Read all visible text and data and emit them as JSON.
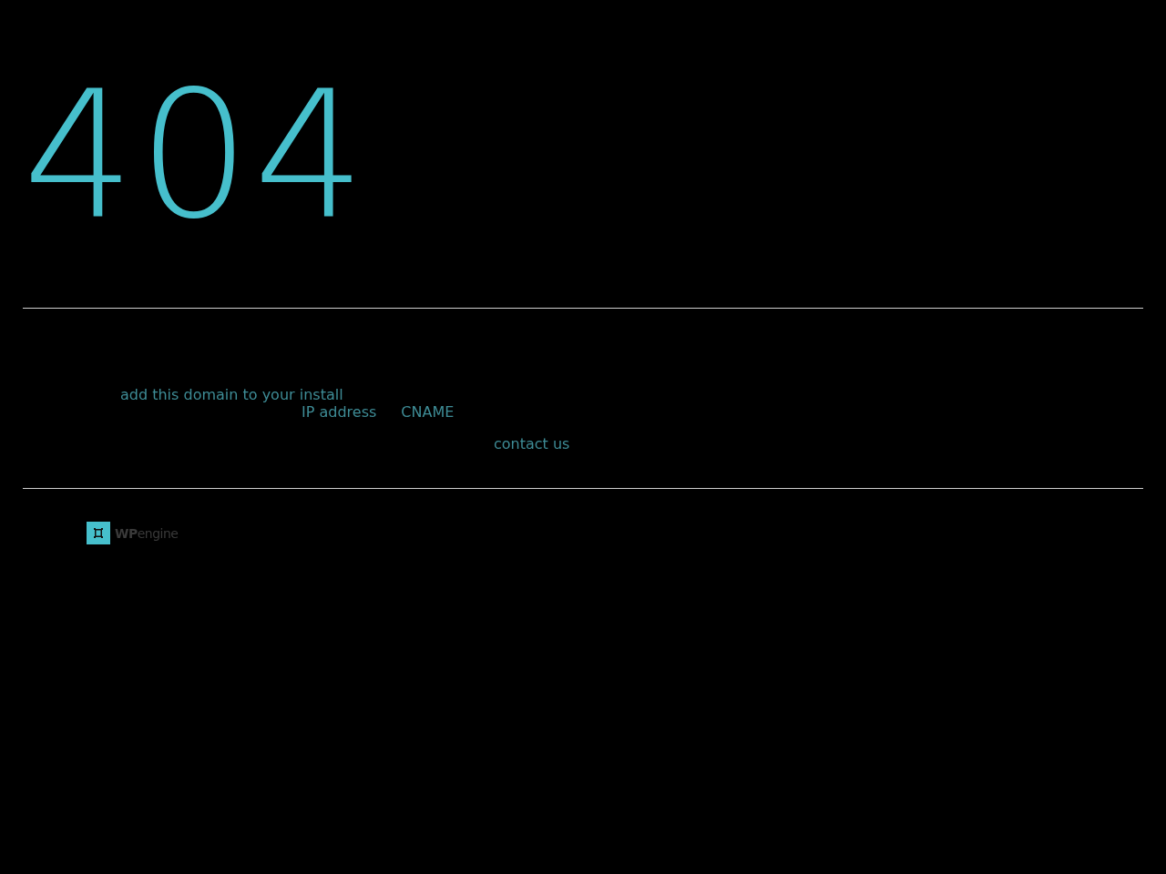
{
  "heading": "404",
  "message": {
    "lines": [
      {
        "links": [
          {
            "text": "add this domain to your install"
          }
        ]
      },
      {
        "links": [
          {
            "text": "IP address"
          },
          {
            "text": "CNAME"
          }
        ]
      },
      {
        "links": [
          {
            "text": "contact us"
          }
        ]
      }
    ]
  },
  "footer": {
    "logo": {
      "text": "**WP**engine"
    }
  }
}
